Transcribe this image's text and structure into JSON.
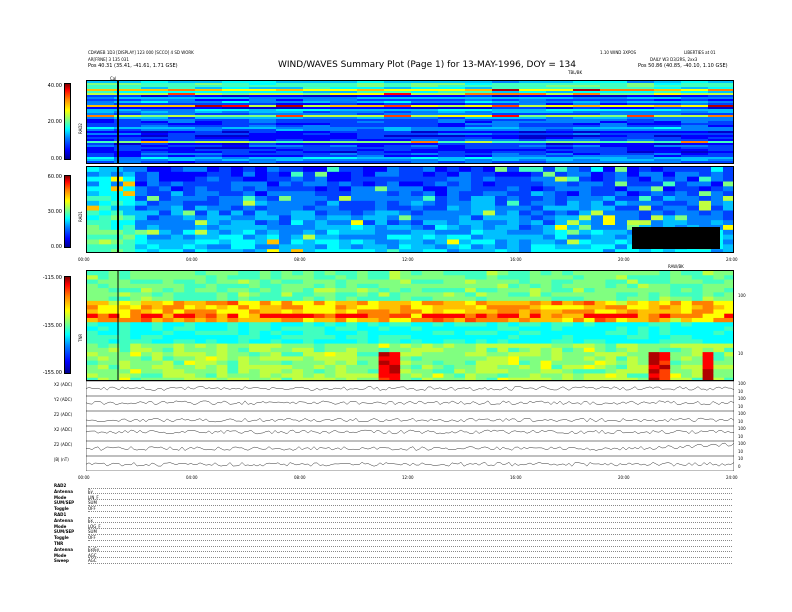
{
  "header": {
    "left_line1": "CDAWEB 1D3 [DISPLAY] 123 000 [SCCO] 4 SD WORK",
    "left_line2": "AR[FRNE] 3 135 031",
    "left_line3": "Pos    40.31 (35.41, -41.61, 1.71 GSE)",
    "cal": "Cal",
    "title": "WIND/WAVES Summary Plot (Page 1) for 13-MAY-1996, DOY = 134",
    "right_line1": "1.10 WIND 3XPOS",
    "right_line2": "LIBERTIES at 01",
    "right_line3": "DAILY W3 D3/2RS, 2xx3",
    "right_line4": "Pos    50.86 (40.85, -40.10, 1.10 GSE)",
    "tb_note": "TBL/BK"
  },
  "chart_data": [
    {
      "type": "heatmap",
      "name": "RAD2",
      "ylabel": "RAD2",
      "yticks": [
        "40.00",
        "20.00",
        "0.00"
      ],
      "ylim": [
        0,
        40
      ]
    },
    {
      "type": "heatmap",
      "name": "RAD1",
      "ylabel": "RAD1",
      "yticks": [
        "60.00",
        "30.00",
        "0.00"
      ],
      "ylim": [
        0,
        60
      ],
      "xticks": [
        "00:00",
        "04:00",
        "08:00",
        "12:00",
        "16:00",
        "20:00",
        "24:00"
      ]
    },
    {
      "type": "heatmap",
      "name": "TNR",
      "ylabel": "TNR",
      "yticks": [
        "-115.00",
        "-135.00",
        "-155.00"
      ],
      "ylim": [
        -155,
        -115
      ],
      "right_ticks": [
        "100",
        "10"
      ],
      "annotation": "RAW/BK"
    },
    {
      "type": "line",
      "stack": [
        {
          "label": "X2 (ADC)",
          "right_ticks": [
            "100",
            "10"
          ],
          "level": 0.5
        },
        {
          "label": "Y2 (ADC)",
          "right_ticks": [
            "100",
            "10"
          ],
          "level": 0.55
        },
        {
          "label": "Z2 (ADC)",
          "right_ticks": [
            "100",
            "10"
          ],
          "level": 0.4
        },
        {
          "label": "X2 (ADC)",
          "right_ticks": [
            "100",
            "10"
          ],
          "level": 0.6
        },
        {
          "label": "Z2 (ADC)",
          "right_ticks": [
            "100",
            "10"
          ],
          "level": 0.5
        },
        {
          "label": "|B| (nT)",
          "right_ticks": [
            "10",
            "0"
          ],
          "level": 0.45
        }
      ],
      "xticks": [
        "00:00",
        "04:00",
        "08:00",
        "12:00",
        "16:00",
        "20:00",
        "24:00"
      ]
    }
  ],
  "info_block": [
    {
      "label": "RAD2",
      "value": ""
    },
    {
      "label": "Antenna",
      "value": "Ey"
    },
    {
      "label": "Mode",
      "value": "LIN_F"
    },
    {
      "label": "SUM/SEP",
      "value": "SUM"
    },
    {
      "label": "Toggle",
      "value": "OFF"
    },
    {
      "label": "RAD1",
      "value": ""
    },
    {
      "label": "Antenna",
      "value": "Ex"
    },
    {
      "label": "Mode",
      "value": "LOG_F"
    },
    {
      "label": "SUM/SEP",
      "value": "SUM"
    },
    {
      "label": "Toggle",
      "value": "OFF"
    },
    {
      "label": "TNR",
      "value": ""
    },
    {
      "label": "Antenna",
      "value": "Ex/Ey"
    },
    {
      "label": "Mode",
      "value": "AGC"
    },
    {
      "label": "Sweep",
      "value": "AGC"
    }
  ],
  "colors": {
    "background": "#ffffff",
    "scale_low": "#00008f",
    "scale_high": "#800000"
  }
}
